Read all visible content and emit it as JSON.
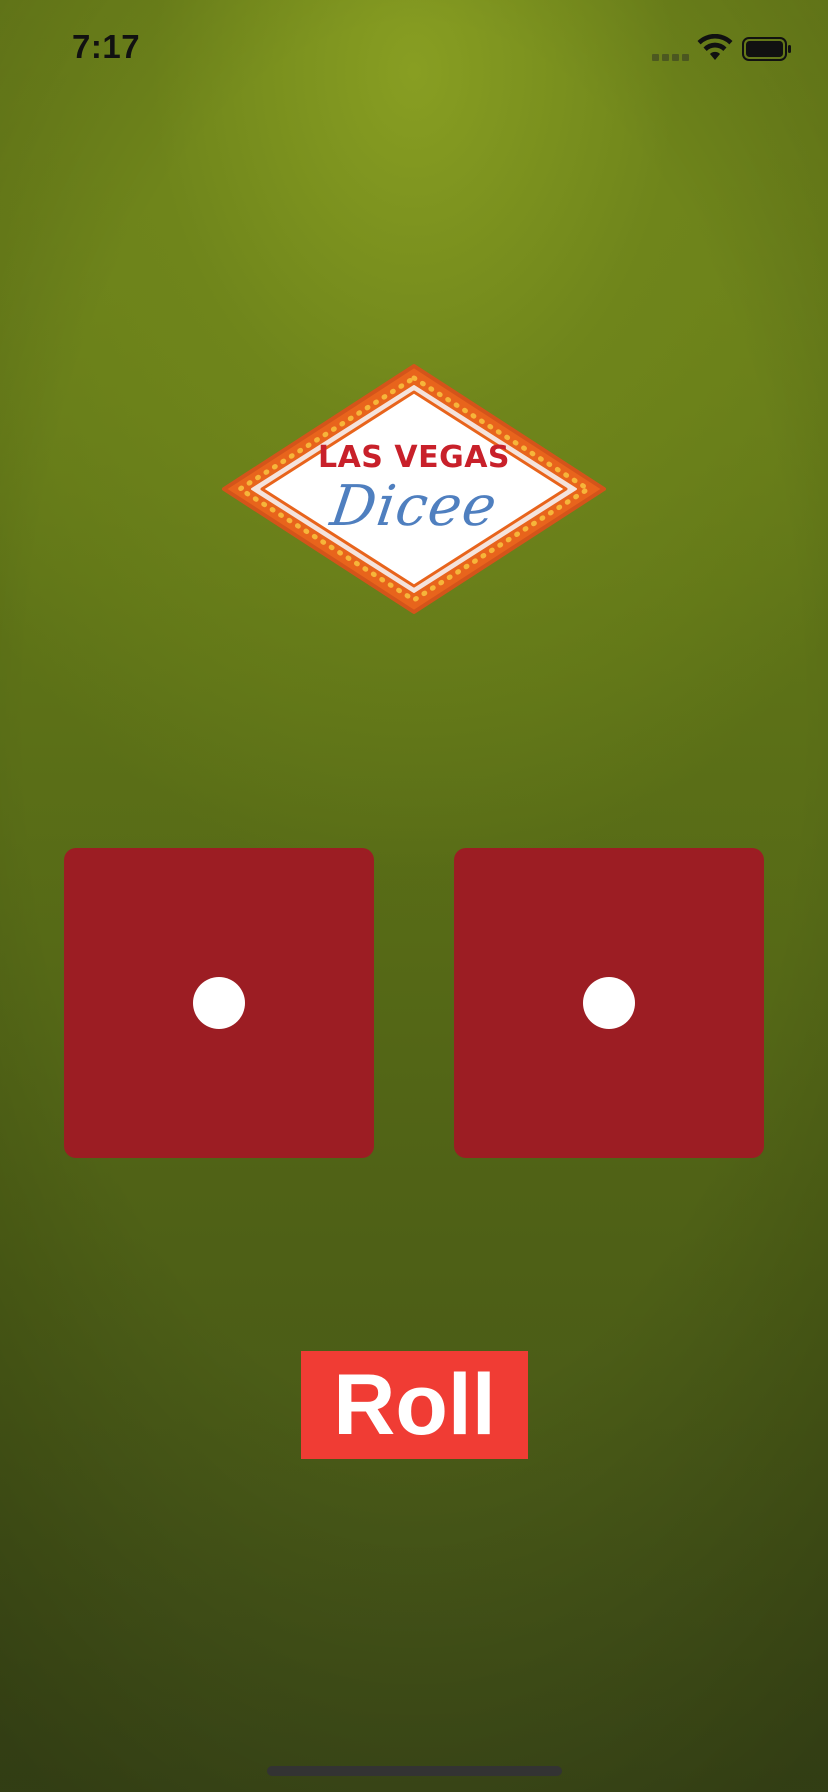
{
  "status_bar": {
    "time": "7:17"
  },
  "logo": {
    "line1": "LAS VEGAS",
    "line2": "Dicee"
  },
  "dice": [
    {
      "name": "left",
      "value": 1
    },
    {
      "name": "right",
      "value": 1
    }
  ],
  "roll_button": {
    "label": "Roll"
  },
  "colors": {
    "background": "#6a7f1b",
    "die": "#9c1d23",
    "pip": "#ffffff",
    "button": "#f03c34",
    "logo_red": "#c8202a",
    "logo_blue": "#4f7fbf",
    "logo_orange": "#e8641c"
  },
  "icons": {
    "signal": "cellular-signal-icon",
    "wifi": "wifi-icon",
    "battery": "battery-icon"
  }
}
